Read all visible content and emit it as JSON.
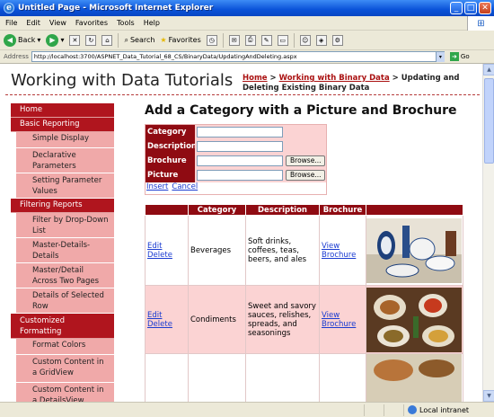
{
  "window": {
    "title": "Untitled Page - Microsoft Internet Explorer",
    "min": "_",
    "max": "□",
    "close": "✕"
  },
  "menu_bar": [
    "File",
    "Edit",
    "View",
    "Favorites",
    "Tools",
    "Help"
  ],
  "toolbar": {
    "back": "Back",
    "search": "Search",
    "favorites": "Favorites"
  },
  "address": {
    "label": "Address",
    "url": "http://localhost:3700/ASPNET_Data_Tutorial_68_CS/BinaryData/UpdatingAndDeleting.aspx",
    "go": "Go"
  },
  "page": {
    "site_title": "Working with Data Tutorials",
    "breadcrumb": {
      "home": "Home",
      "sep1": " > ",
      "parent": "Working with Binary Data",
      "current": " > Updating and Deleting Existing Binary Data"
    },
    "heading": "Add a Category with a Picture and Brochure",
    "sidebar": [
      {
        "type": "header",
        "label": "Home"
      },
      {
        "type": "header",
        "label": "Basic Reporting"
      },
      {
        "type": "item",
        "label": "Simple Display",
        "size": 1
      },
      {
        "type": "item",
        "label": "Declarative Parameters",
        "size": 2
      },
      {
        "type": "item",
        "label": "Setting Parameter Values",
        "size": 2
      },
      {
        "type": "header",
        "label": "Filtering Reports"
      },
      {
        "type": "item",
        "label": "Filter by Drop-Down List",
        "size": 2
      },
      {
        "type": "item",
        "label": "Master-Details-Details",
        "size": 2
      },
      {
        "type": "item",
        "label": "Master/Detail Across Two Pages",
        "size": 2
      },
      {
        "type": "item",
        "label": "Details of Selected Row",
        "size": 2
      },
      {
        "type": "header2",
        "label": "Customized Formatting"
      },
      {
        "type": "item",
        "label": "Format Colors",
        "size": 1
      },
      {
        "type": "item",
        "label": "Custom Content in a GridView",
        "size": 2
      },
      {
        "type": "item",
        "label": "Custom Content in a DetailsView",
        "size": 2
      }
    ],
    "form": {
      "fields": [
        {
          "label": "Category",
          "kind": "text",
          "value": ""
        },
        {
          "label": "Description",
          "kind": "text",
          "value": ""
        },
        {
          "label": "Brochure",
          "kind": "file",
          "value": ""
        },
        {
          "label": "Picture",
          "kind": "file",
          "value": ""
        }
      ],
      "browse_label": "Browse...",
      "insert_label": "Insert",
      "cancel_label": "Cancel"
    },
    "grid": {
      "columns": [
        "",
        "Category",
        "Description",
        "Brochure",
        ""
      ],
      "rows": [
        {
          "edit": "Edit",
          "delete": "Delete",
          "category": "Beverages",
          "description": "Soft drinks, coffees, teas, beers, and ales",
          "brochure": "View Brochure"
        },
        {
          "edit": "Edit",
          "delete": "Delete",
          "category": "Condiments",
          "description": "Sweet and savory sauces, relishes, spreads, and seasonings",
          "brochure": "View Brochure"
        },
        {
          "edit": "",
          "delete": "",
          "category": "",
          "description": "",
          "brochure": ""
        }
      ]
    }
  },
  "status": {
    "zone": "Local intranet"
  },
  "colors": {
    "header_red": "#8f0b12",
    "menu_red": "#b0151e",
    "menu_pink": "#f0a9a9",
    "row_pink": "#fbd3d3",
    "link_blue": "#1a3bd1"
  }
}
